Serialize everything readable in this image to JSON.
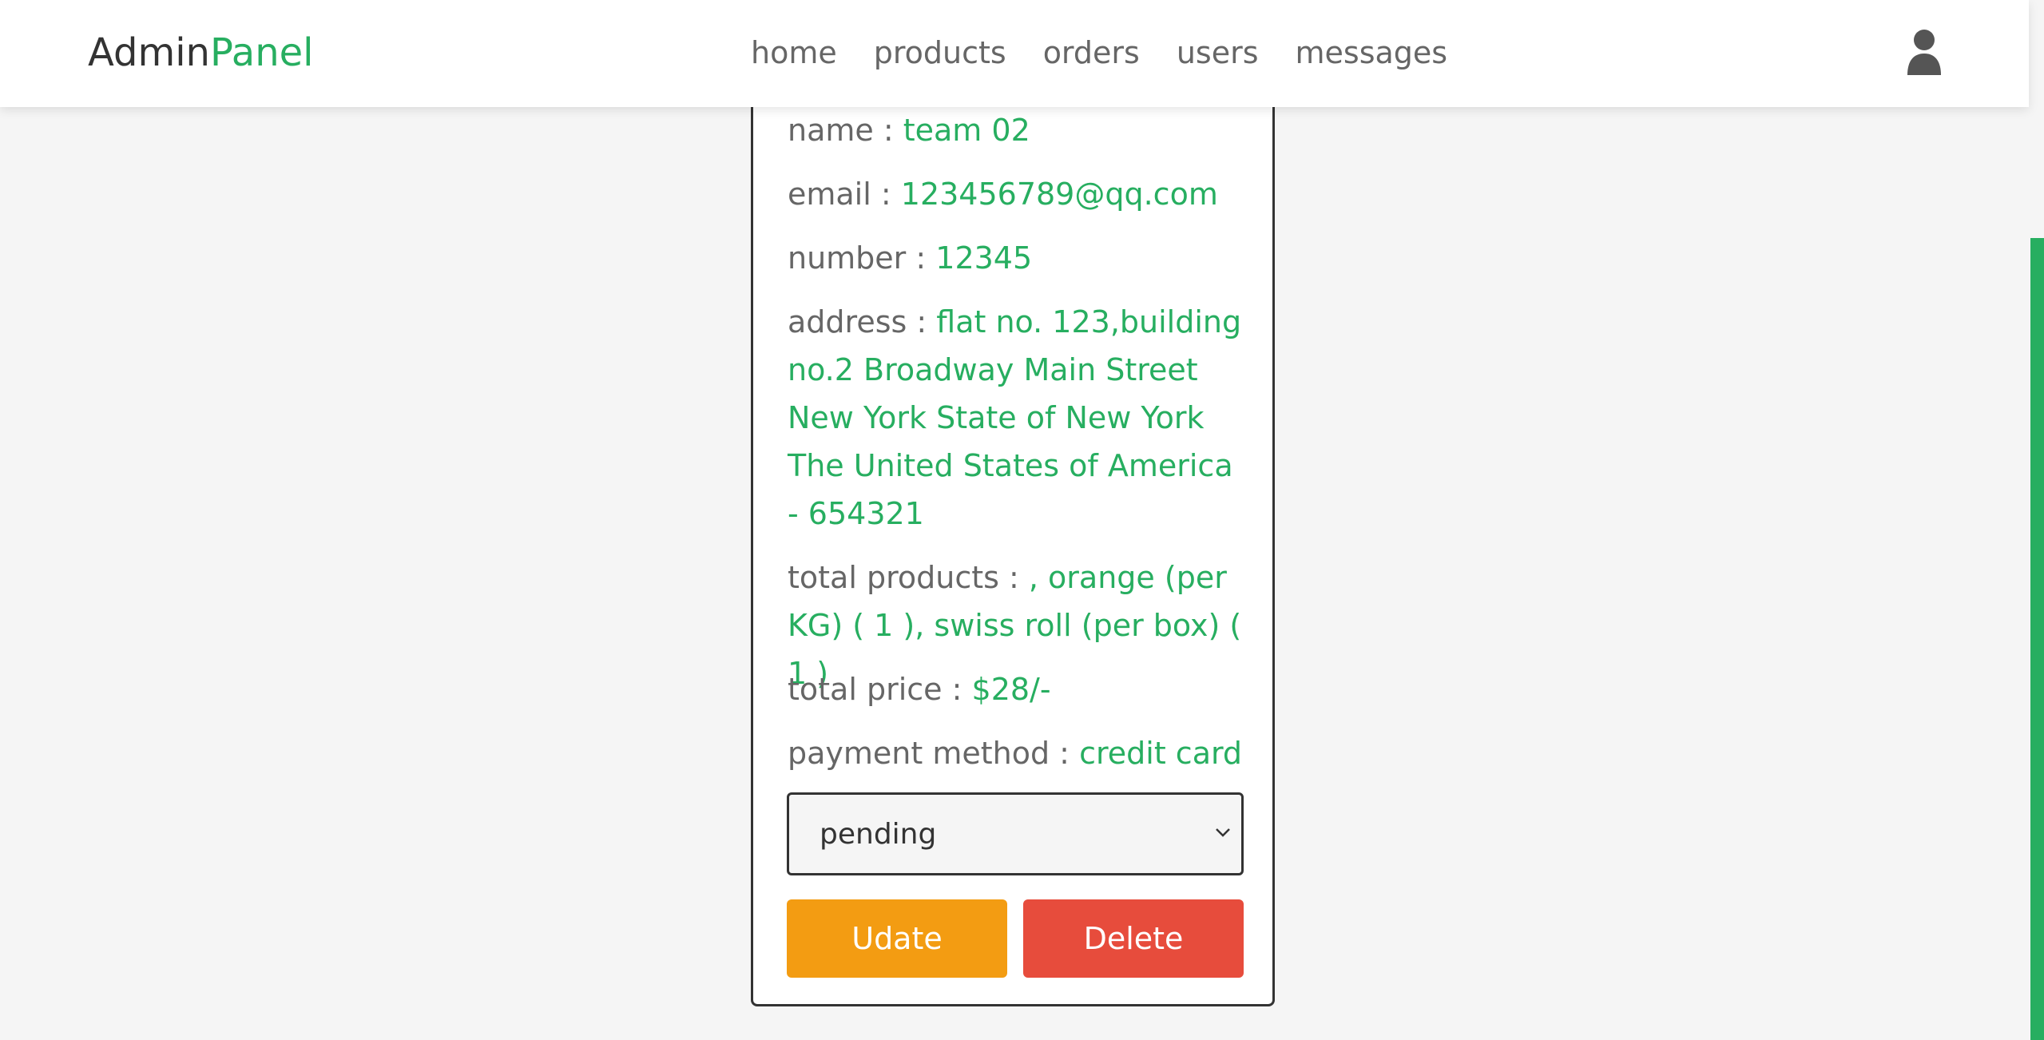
{
  "header": {
    "logo_main": "Admin",
    "logo_accent": "Panel",
    "nav": [
      "home",
      "products",
      "orders",
      "users",
      "messages"
    ],
    "user_icon": "user-icon"
  },
  "order": {
    "name_label": "name : ",
    "name": "team 02",
    "email_label": "email : ",
    "email": "123456789@qq.com",
    "number_label": "number : ",
    "number": "12345",
    "address_label": "address : ",
    "address": "flat no. 123,building no.2 Broadway Main Street New York State of New York The United States of America - 654321",
    "total_products_label": "total products : ",
    "total_products": ", orange (per KG) ( 1 ), swiss roll (per box) ( 1 )",
    "total_price_label": "total price : ",
    "total_price": "$28/-",
    "payment_method_label": "payment method : ",
    "payment_method": "credit card",
    "status": "pending",
    "update_label": "Udate",
    "delete_label": "Delete"
  },
  "colors": {
    "accent": "#27ae60",
    "update": "#f39c12",
    "delete": "#e74c3c"
  }
}
